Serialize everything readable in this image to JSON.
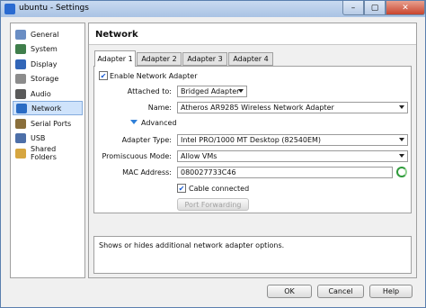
{
  "window": {
    "title": "ubuntu - Settings",
    "minimize": "–",
    "maximize": "▢",
    "close": "✕"
  },
  "sidebar": {
    "items": [
      {
        "label": "General",
        "color": "#6a8ec4"
      },
      {
        "label": "System",
        "color": "#3f7e4b"
      },
      {
        "label": "Display",
        "color": "#3266b8"
      },
      {
        "label": "Storage",
        "color": "#8c8c8c"
      },
      {
        "label": "Audio",
        "color": "#5a5a5a"
      },
      {
        "label": "Network",
        "color": "#2b6cc4"
      },
      {
        "label": "Serial Ports",
        "color": "#8a6f3b"
      },
      {
        "label": "USB",
        "color": "#4d6fa8"
      },
      {
        "label": "Shared Folders",
        "color": "#d6a640"
      }
    ],
    "selected": "Network"
  },
  "panel": {
    "title": "Network"
  },
  "tabs": [
    "Adapter 1",
    "Adapter 2",
    "Adapter 3",
    "Adapter 4"
  ],
  "adapter": {
    "enable_label": "Enable Network Adapter",
    "enable_checked": "✔",
    "attached_label": "Attached to:",
    "attached_value": "Bridged Adapter",
    "name_label": "Name:",
    "name_value": "Atheros AR9285 Wireless Network Adapter",
    "advanced_label": "Advanced",
    "adapter_type_label": "Adapter Type:",
    "adapter_type_value": "Intel PRO/1000 MT Desktop (82540EM)",
    "promiscuous_label": "Promiscuous Mode:",
    "promiscuous_value": "Allow VMs",
    "mac_label": "MAC Address:",
    "mac_value": "080027733C46",
    "cable_label": "Cable connected",
    "cable_checked": "✔",
    "port_forwarding": "Port Forwarding"
  },
  "info": {
    "text": "Shows or hides additional network adapter options."
  },
  "buttons": {
    "ok": "OK",
    "cancel": "Cancel",
    "help": "Help"
  }
}
